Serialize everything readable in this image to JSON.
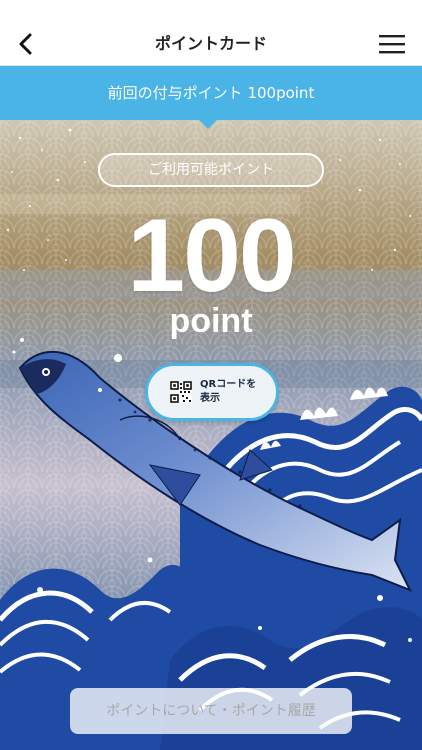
{
  "header": {
    "title": "ポイントカード",
    "back_icon": "chevron-left-icon",
    "menu_icon": "hamburger-menu-icon"
  },
  "banner": {
    "text": "前回の付与ポイント 100point"
  },
  "card": {
    "available_label": "ご利用可能ポイント",
    "points_value": "100",
    "points_unit": "point",
    "qr_button_label": "QRコードを\n表示",
    "qr_icon": "qr-code-icon",
    "info_button_label": "ポイントについて・ポイント履歴"
  },
  "colors": {
    "accent": "#4ab4e6",
    "wave_blue": "#1f4ba5",
    "sky_gold": "#a58a58"
  }
}
